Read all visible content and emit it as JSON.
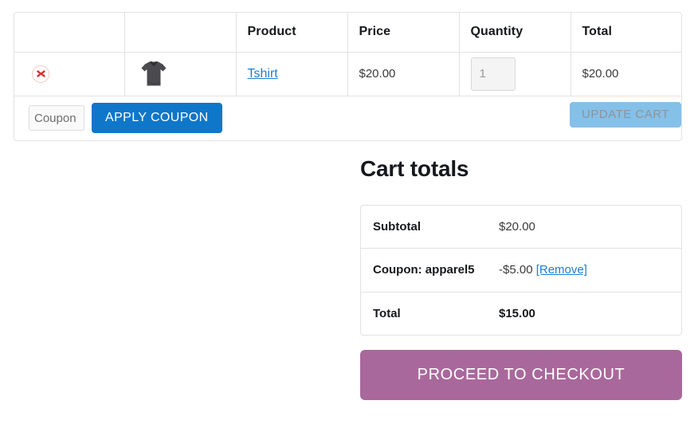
{
  "cart_table": {
    "headers": [
      "",
      "",
      "Product",
      "Price",
      "Quantity",
      "Total"
    ],
    "rows": [
      {
        "remove_icon": "remove-x-icon",
        "thumbnail_icon": "tshirt-thumbnail",
        "product": "Tshirt",
        "price": "$20.00",
        "quantity": "1",
        "total": "$20.00"
      }
    ]
  },
  "actions": {
    "coupon_placeholder": "Coupon",
    "coupon_value": "",
    "apply_coupon_label": "APPLY COUPON",
    "update_cart_label": "UPDATE CART"
  },
  "cart_totals": {
    "heading": "Cart totals",
    "rows": [
      {
        "label": "Subtotal",
        "value": "$20.00",
        "link": ""
      },
      {
        "label": "Coupon: apparel5",
        "value": "-$5.00",
        "link": "[Remove]"
      },
      {
        "label": "Total",
        "value": "$15.00",
        "link": ""
      }
    ]
  },
  "checkout": {
    "label": "PROCEED TO CHECKOUT"
  },
  "colors": {
    "apply_button": "#0f77c9",
    "update_button": "#85c0e8",
    "checkout_button": "#a9689b",
    "link": "#1a7fd4",
    "remove_x": "#e02b2b",
    "border": "#e2e2e2"
  }
}
